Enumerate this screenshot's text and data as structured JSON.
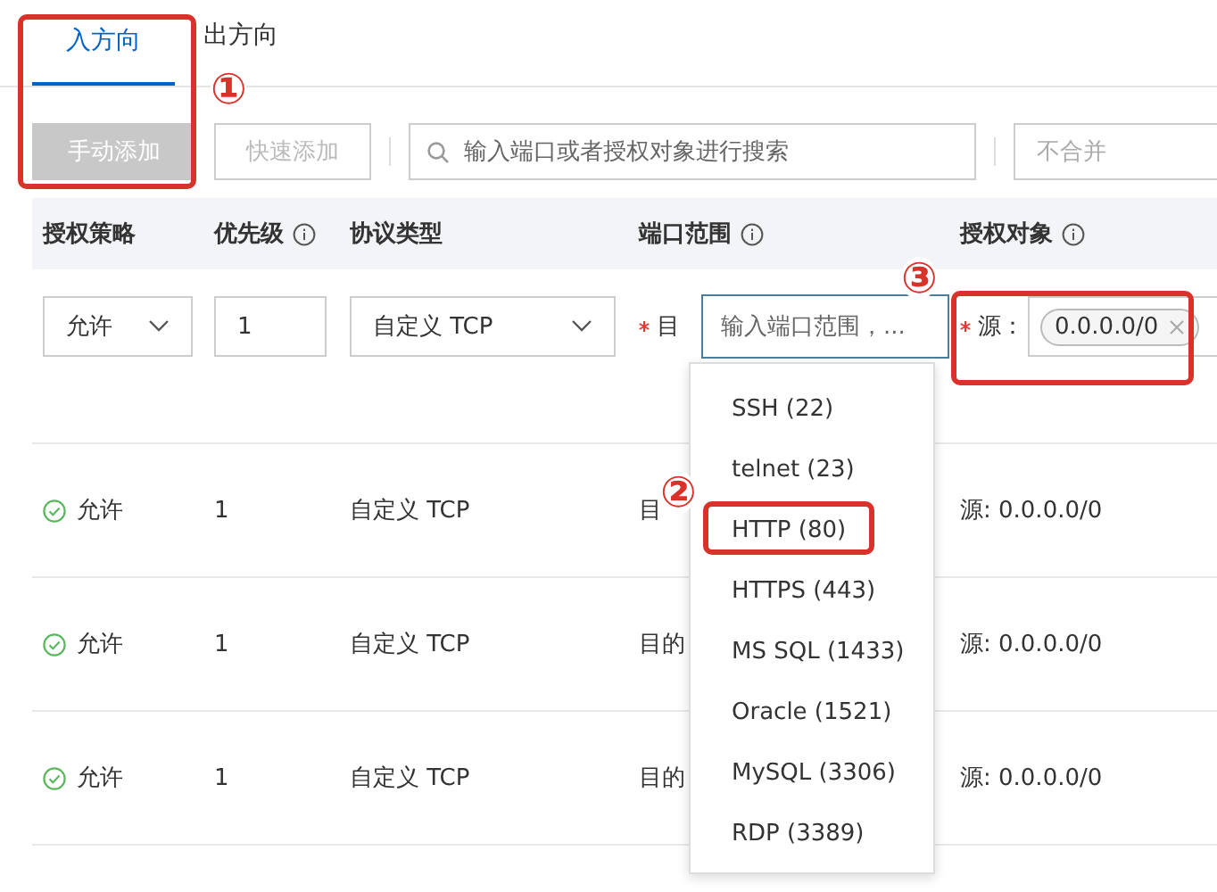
{
  "tabs": [
    {
      "label": "入方向",
      "selected": true
    },
    {
      "label": "出方向",
      "selected": false
    }
  ],
  "toolbar": {
    "buttons": [
      {
        "label": "手动添加",
        "disabled": true
      },
      {
        "label": "快速添加",
        "disabled": true
      }
    ],
    "search": {
      "placeholder": "输入端口或者授权对象进行搜索"
    },
    "merge_select": {
      "value": "不合并"
    }
  },
  "table": {
    "columns": [
      {
        "label": "授权策略",
        "info": false
      },
      {
        "label": "优先级",
        "info": true
      },
      {
        "label": "协议类型",
        "info": false
      },
      {
        "label": "端口范围",
        "info": true
      },
      {
        "label": "授权对象",
        "info": true
      }
    ],
    "edit_row": {
      "policy": "允许",
      "priority": "1",
      "protocol": "自定义 TCP",
      "port_required": true,
      "source_required": true,
      "port_label": "目",
      "port_placeholder": "输入端口范围，...",
      "source_label": "源：",
      "source_tag": "0.0.0.0/0"
    },
    "rows": [
      {
        "policy": "允许",
        "priority": "1",
        "protocol": "自定义 TCP",
        "port": "目",
        "source": "源: 0.0.0.0/0"
      },
      {
        "policy": "允许",
        "priority": "1",
        "protocol": "自定义 TCP",
        "port": "目的",
        "source": "源: 0.0.0.0/0"
      },
      {
        "policy": "允许",
        "priority": "1",
        "protocol": "自定义 TCP",
        "port": "目的",
        "source": "源: 0.0.0.0/0"
      }
    ]
  },
  "port_dropdown": [
    {
      "label": "SSH (22)"
    },
    {
      "label": "telnet (23)"
    },
    {
      "label": "HTTP (80)"
    },
    {
      "label": "HTTPS (443)"
    },
    {
      "label": "MS SQL (1433)"
    },
    {
      "label": "Oracle (1521)"
    },
    {
      "label": "MySQL (3306)"
    },
    {
      "label": "RDP (3389)"
    }
  ],
  "annotations": [
    {
      "label": "①"
    },
    {
      "label": "②"
    },
    {
      "label": "③"
    }
  ]
}
